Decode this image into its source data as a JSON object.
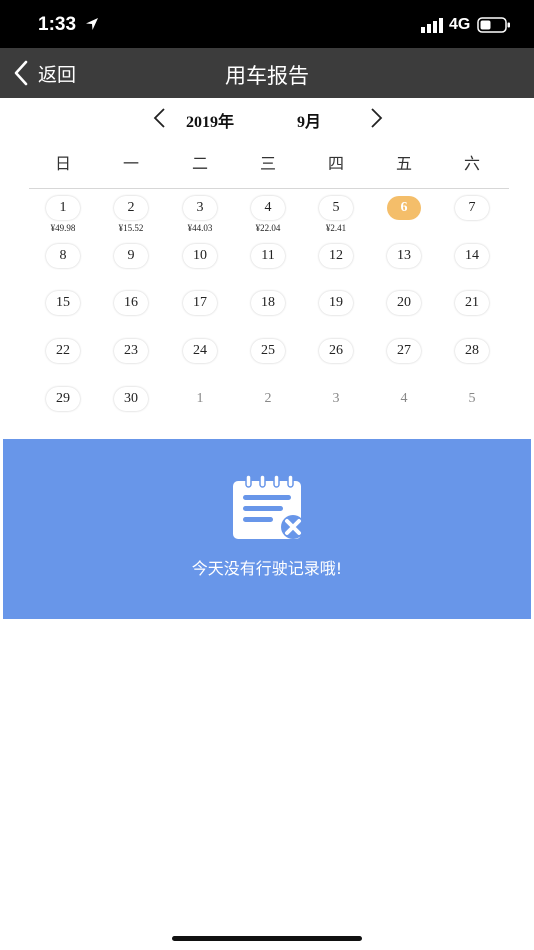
{
  "status_bar": {
    "time": "1:33",
    "network": "4G"
  },
  "nav": {
    "back_label": "返回",
    "title": "用车报告"
  },
  "calendar": {
    "year_label": "2019年",
    "month_label": "9月",
    "weekdays": [
      "日",
      "一",
      "二",
      "三",
      "四",
      "五",
      "六"
    ],
    "days": [
      {
        "label": "1",
        "amount": "¥49.98",
        "current": true
      },
      {
        "label": "2",
        "amount": "¥15.52",
        "current": true
      },
      {
        "label": "3",
        "amount": "¥44.03",
        "current": true
      },
      {
        "label": "4",
        "amount": "¥22.04",
        "current": true
      },
      {
        "label": "5",
        "amount": "¥2.41",
        "current": true
      },
      {
        "label": "6",
        "amount": "",
        "current": true,
        "selected": true
      },
      {
        "label": "7",
        "amount": "",
        "current": true
      },
      {
        "label": "8",
        "amount": "",
        "current": true
      },
      {
        "label": "9",
        "amount": "",
        "current": true
      },
      {
        "label": "10",
        "amount": "",
        "current": true
      },
      {
        "label": "11",
        "amount": "",
        "current": true
      },
      {
        "label": "12",
        "amount": "",
        "current": true
      },
      {
        "label": "13",
        "amount": "",
        "current": true
      },
      {
        "label": "14",
        "amount": "",
        "current": true
      },
      {
        "label": "15",
        "amount": "",
        "current": true
      },
      {
        "label": "16",
        "amount": "",
        "current": true
      },
      {
        "label": "17",
        "amount": "",
        "current": true
      },
      {
        "label": "18",
        "amount": "",
        "current": true
      },
      {
        "label": "19",
        "amount": "",
        "current": true
      },
      {
        "label": "20",
        "amount": "",
        "current": true
      },
      {
        "label": "21",
        "amount": "",
        "current": true
      },
      {
        "label": "22",
        "amount": "",
        "current": true
      },
      {
        "label": "23",
        "amount": "",
        "current": true
      },
      {
        "label": "24",
        "amount": "",
        "current": true
      },
      {
        "label": "25",
        "amount": "",
        "current": true
      },
      {
        "label": "26",
        "amount": "",
        "current": true
      },
      {
        "label": "27",
        "amount": "",
        "current": true
      },
      {
        "label": "28",
        "amount": "",
        "current": true
      },
      {
        "label": "29",
        "amount": "",
        "current": true
      },
      {
        "label": "30",
        "amount": "",
        "current": true
      },
      {
        "label": "1",
        "amount": "",
        "current": false
      },
      {
        "label": "2",
        "amount": "",
        "current": false
      },
      {
        "label": "3",
        "amount": "",
        "current": false
      },
      {
        "label": "4",
        "amount": "",
        "current": false
      },
      {
        "label": "5",
        "amount": "",
        "current": false
      }
    ]
  },
  "empty_state": {
    "icon": "notepad-x-icon",
    "message": "今天没有行驶记录哦!"
  },
  "colors": {
    "nav_bg": "#3c3c3c",
    "selected_day": "#f4be6a",
    "empty_panel_bg": "#6896e9"
  }
}
